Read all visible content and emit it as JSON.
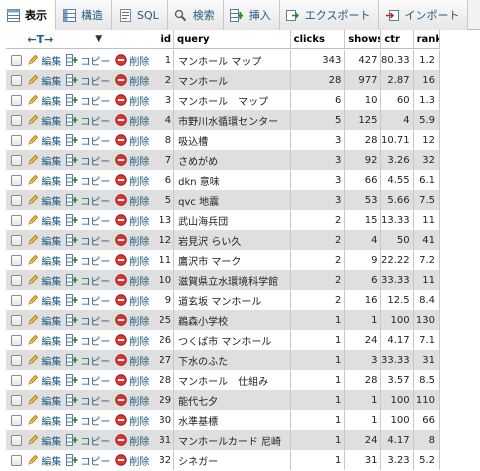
{
  "tabs": [
    {
      "label": "表示",
      "icon": "browse-table-icon",
      "active": true
    },
    {
      "label": "構造",
      "icon": "structure-icon",
      "active": false
    },
    {
      "label": "SQL",
      "icon": "sql-icon",
      "active": false
    },
    {
      "label": "検索",
      "icon": "search-icon",
      "active": false
    },
    {
      "label": "挿入",
      "icon": "insert-icon",
      "active": false
    },
    {
      "label": "エクスポート",
      "icon": "export-icon",
      "active": false
    },
    {
      "label": "インポート",
      "icon": "import-icon",
      "active": false
    }
  ],
  "header": {
    "arrows": "←T→",
    "sort_marker": "▼",
    "columns": {
      "id": "id",
      "query": "query",
      "clicks": "clicks",
      "shows": "shows",
      "ctr": "ctr",
      "rank": "rank"
    }
  },
  "actions": {
    "edit": "編集",
    "copy": "コピー",
    "delete": "削除"
  },
  "rows": [
    {
      "id": "1",
      "query": "マンホール マップ",
      "clicks": "343",
      "shows": "427",
      "ctr": "80.33",
      "rank": "1.2"
    },
    {
      "id": "2",
      "query": "マンホール",
      "clicks": "28",
      "shows": "977",
      "ctr": "2.87",
      "rank": "16"
    },
    {
      "id": "3",
      "query": "マンホール　マップ",
      "clicks": "6",
      "shows": "10",
      "ctr": "60",
      "rank": "1.3"
    },
    {
      "id": "4",
      "query": "市野川水循環センター",
      "clicks": "5",
      "shows": "125",
      "ctr": "4",
      "rank": "5.9"
    },
    {
      "id": "8",
      "query": "吸込槽",
      "clicks": "3",
      "shows": "28",
      "ctr": "10.71",
      "rank": "12"
    },
    {
      "id": "7",
      "query": "さめがめ",
      "clicks": "3",
      "shows": "92",
      "ctr": "3.26",
      "rank": "32"
    },
    {
      "id": "6",
      "query": "dkn 意味",
      "clicks": "3",
      "shows": "66",
      "ctr": "4.55",
      "rank": "6.1"
    },
    {
      "id": "5",
      "query": "qvc 地震",
      "clicks": "3",
      "shows": "53",
      "ctr": "5.66",
      "rank": "7.5"
    },
    {
      "id": "13",
      "query": "武山海兵団",
      "clicks": "2",
      "shows": "15",
      "ctr": "13.33",
      "rank": "11"
    },
    {
      "id": "12",
      "query": "岩見沢 らい久",
      "clicks": "2",
      "shows": "4",
      "ctr": "50",
      "rank": "41"
    },
    {
      "id": "11",
      "query": "鷹沢市 マーク",
      "clicks": "2",
      "shows": "9",
      "ctr": "22.22",
      "rank": "7.2"
    },
    {
      "id": "10",
      "query": "滋賀県立水環境科学館",
      "clicks": "2",
      "shows": "6",
      "ctr": "33.33",
      "rank": "11"
    },
    {
      "id": "9",
      "query": "道玄坂 マンホール",
      "clicks": "2",
      "shows": "16",
      "ctr": "12.5",
      "rank": "8.4"
    },
    {
      "id": "25",
      "query": "鵜森小学校",
      "clicks": "1",
      "shows": "1",
      "ctr": "100",
      "rank": "130"
    },
    {
      "id": "26",
      "query": "つくば市 マンホール",
      "clicks": "1",
      "shows": "24",
      "ctr": "4.17",
      "rank": "7.1"
    },
    {
      "id": "27",
      "query": "下水のふた",
      "clicks": "1",
      "shows": "3",
      "ctr": "33.33",
      "rank": "31"
    },
    {
      "id": "28",
      "query": "マンホール　仕組み",
      "clicks": "1",
      "shows": "28",
      "ctr": "3.57",
      "rank": "8.5"
    },
    {
      "id": "29",
      "query": "能代七夕",
      "clicks": "1",
      "shows": "1",
      "ctr": "100",
      "rank": "110"
    },
    {
      "id": "30",
      "query": "水準基標",
      "clicks": "1",
      "shows": "1",
      "ctr": "100",
      "rank": "66"
    },
    {
      "id": "31",
      "query": "マンホールカード 尼崎",
      "clicks": "1",
      "shows": "24",
      "ctr": "4.17",
      "rank": "8"
    },
    {
      "id": "32",
      "query": "シネガー",
      "clicks": "1",
      "shows": "31",
      "ctr": "3.23",
      "rank": "5.2"
    }
  ]
}
